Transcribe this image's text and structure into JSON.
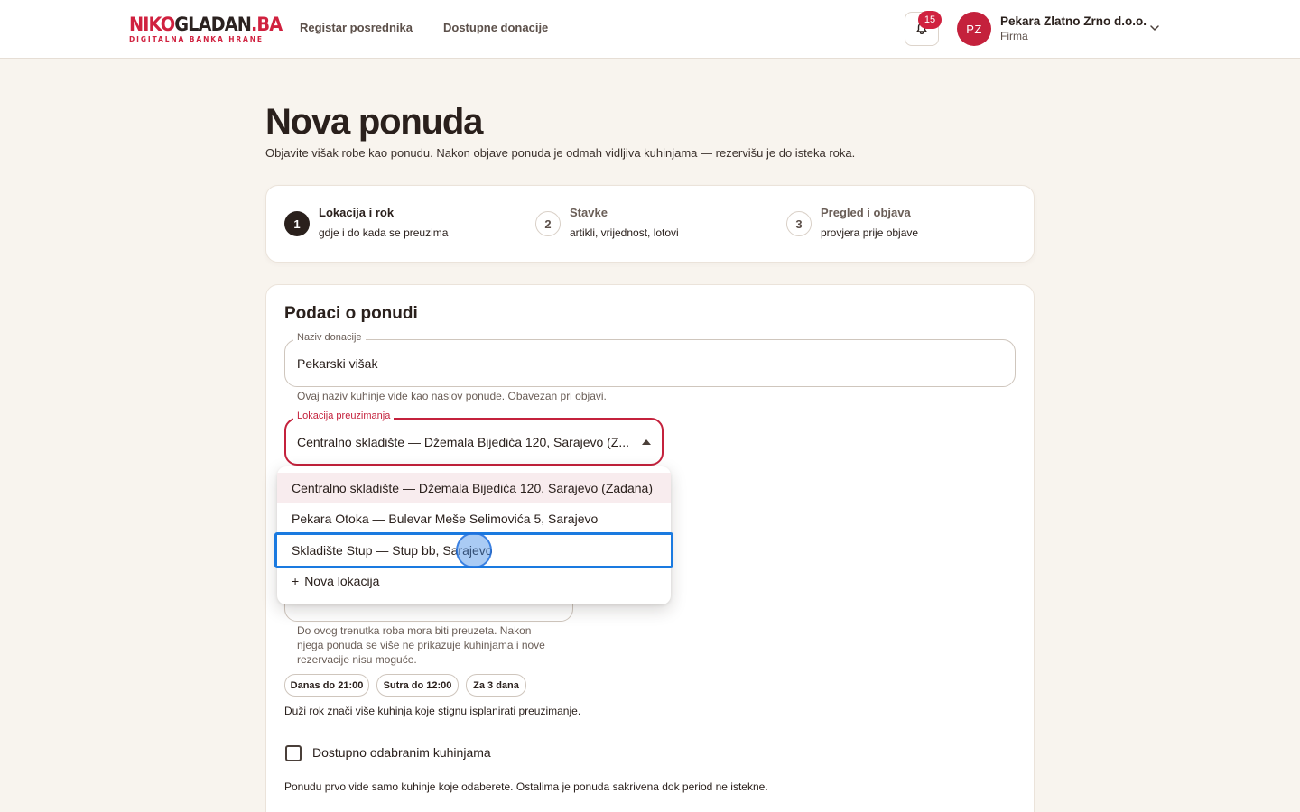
{
  "brand": {
    "logo_red": "NIKO",
    "logo_dark": "GLADAN",
    "logo_red2": ".BA",
    "tagline": "DIGITALNA BANKA HRANE",
    "accent_color": "#d0213f"
  },
  "nav": {
    "items": [
      {
        "label": "Registar posrednika"
      },
      {
        "label": "Dostupne donacije"
      }
    ]
  },
  "notifications": {
    "count": "15",
    "icon": "bell-icon"
  },
  "user": {
    "initials": "PZ",
    "name": "Pekara Zlatno Zrno d.o.o.",
    "role": "Firma",
    "menu_icon": "chevron-down-icon"
  },
  "page": {
    "title": "Nova ponuda",
    "subtitle": "Objavite višak robe kao ponudu. Nakon objave ponuda je odmah vidljiva kuhinjama — rezervišu je do isteka roka."
  },
  "stepper": {
    "steps": [
      {
        "number": "1",
        "title": "Lokacija i rok",
        "desc": "gdje i do kada se preuzima",
        "active": true
      },
      {
        "number": "2",
        "title": "Stavke",
        "desc": "artikli, vrijednost, lotovi",
        "active": false
      },
      {
        "number": "3",
        "title": "Pregled i objava",
        "desc": "provjera prije objave",
        "active": false
      }
    ]
  },
  "form": {
    "section_title": "Podaci o ponudi",
    "name_field": {
      "label": "Naziv donacije",
      "value": "Pekarski višak",
      "helper": "Ovaj naziv kuhinje vide kao naslov ponude. Obavezan pri objavi."
    },
    "location_field": {
      "label": "Lokacija preuzimanja",
      "value": "Centralno skladište — Džemala Bijedića 120, Sarajevo (Z...",
      "options": [
        {
          "label": "Centralno skladište — Džemala Bijedića 120, Sarajevo (Zadana)"
        },
        {
          "label": "Pekara Otoka — Bulevar Meše Selimovića 5, Sarajevo"
        },
        {
          "label": "Skladište Stup — Stup bb, Sarajevo"
        },
        {
          "label": "Nova lokacija",
          "icon": "+"
        }
      ]
    },
    "deadline": {
      "helper_lines": [
        "Do ovog trenutka roba mora biti preuzeta. Nakon",
        "njega ponuda se više ne prikazuje kuhinjama i nove",
        "rezervacije nisu moguće."
      ],
      "chips": [
        {
          "label": "Danas do 21:00"
        },
        {
          "label": "Sutra do 12:00"
        },
        {
          "label": "Za 3 dana"
        }
      ],
      "note": "Duži rok znači više kuhinja koje stignu isplanirati preuzimanje."
    },
    "selected_kitchens": {
      "label": "Dostupno odabranim kuhinjama",
      "checked": false,
      "note": "Ponudu prvo vide samo kuhinje koje odaberete. Ostalima je ponuda sakrivena dok period ne istekne."
    }
  }
}
